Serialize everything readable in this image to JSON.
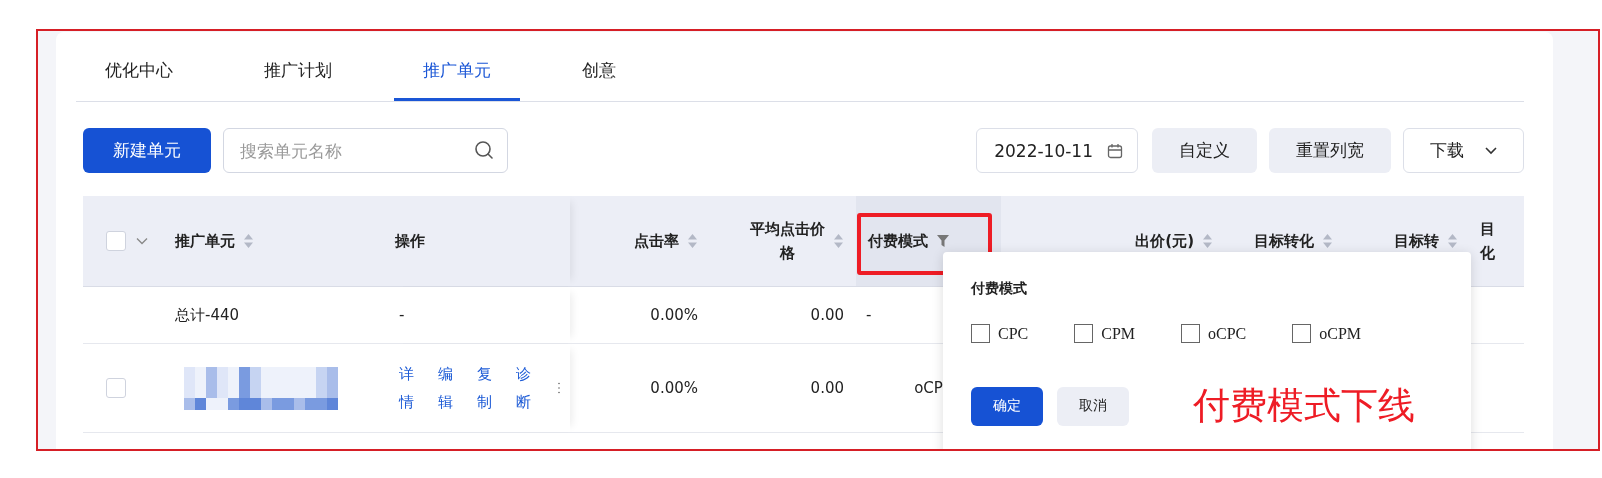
{
  "tabs": [
    {
      "label": "优化中心",
      "selected": false
    },
    {
      "label": "推广计划",
      "selected": false
    },
    {
      "label": "推广单元",
      "selected": true
    },
    {
      "label": "创意",
      "selected": false
    }
  ],
  "toolbar": {
    "new_button": "新建单元",
    "search": {
      "placeholder": "搜索单元名称"
    },
    "date": "2022-10-11",
    "buttons": [
      {
        "label": "自定义",
        "kind": "filled"
      },
      {
        "label": "重置列宽",
        "kind": "filled"
      },
      {
        "label": "下载",
        "kind": "dropdown"
      }
    ]
  },
  "table": {
    "select_all": {
      "checked": false
    },
    "columns": [
      {
        "lines": [
          "推广单元"
        ],
        "sort": true
      },
      {
        "lines": [
          "操作"
        ],
        "sort": false
      },
      {
        "lines": [
          "点击率"
        ],
        "sort": true
      },
      {
        "lines": [
          "平均点击价",
          "格"
        ],
        "sort": true
      },
      {
        "lines": [
          "付费模式"
        ],
        "filter": true,
        "highlighted": true
      },
      {
        "lines": [
          "出价(元)"
        ],
        "sort": true
      },
      {
        "lines": [
          "目标转化"
        ],
        "sort": true
      },
      {
        "lines": [
          "目标转"
        ],
        "sort": true
      },
      {
        "lines": [
          "目",
          "化"
        ],
        "sort": false
      }
    ],
    "rows": [
      {
        "kind": "total",
        "cells": [
          "总计-440",
          "-",
          "0.00%",
          "0.00",
          "-"
        ]
      },
      {
        "kind": "unit",
        "checked": false,
        "actions": [
          "详情",
          "编辑",
          "复制",
          "诊断"
        ],
        "cells": [
          "",
          "",
          "0.00%",
          "0.00",
          "oCP"
        ]
      }
    ]
  },
  "filter_popup": {
    "title": "付费模式",
    "options": [
      {
        "label": "CPC",
        "checked": false
      },
      {
        "label": "CPM",
        "checked": false
      },
      {
        "label": "oCPC",
        "checked": false
      },
      {
        "label": "oCPM",
        "checked": false
      }
    ],
    "confirm": "确定",
    "cancel": "取消",
    "annotation": "付费模式下线"
  }
}
